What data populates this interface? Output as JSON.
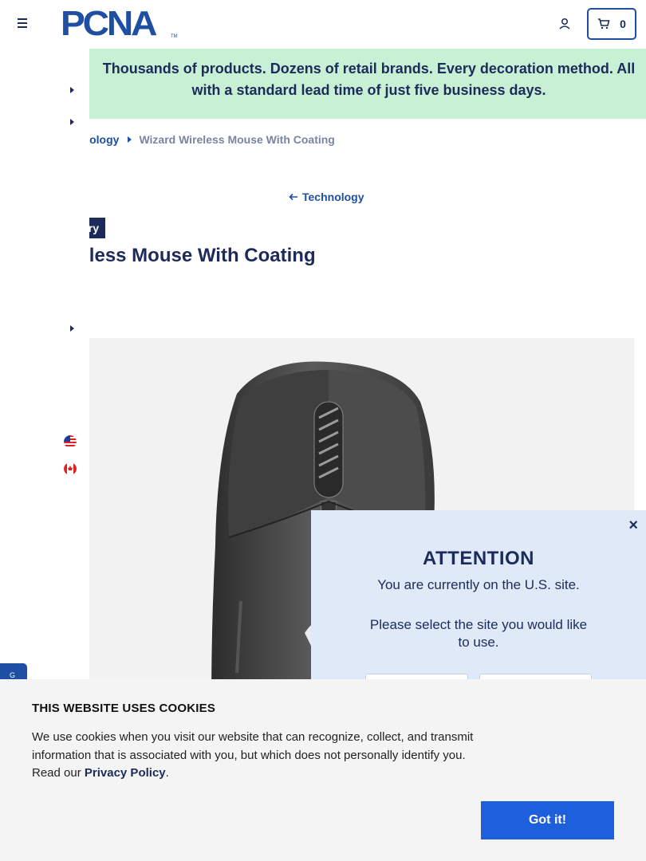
{
  "header": {
    "logo_text": "PCNA",
    "logo_tm": "TM",
    "cart_count": "0",
    "accent_color": "#1e4fa3"
  },
  "promo": {
    "text": "Thousands of products. Dozens of retail brands. Every decoration method. All with a standard lead time of just five business days.",
    "background": "#c8f0d5"
  },
  "breadcrumb": {
    "parent": "hnology",
    "current": "Wizard Wireless Mouse With Coating"
  },
  "back_link": "Technology",
  "badge": "ry",
  "product_title": "Wireless Mouse With Coating",
  "feedback_tab": "G",
  "attention": {
    "close": "×",
    "title": "ATTENTION",
    "line1": "You are currently on the U.S. site.",
    "line2": "Please select the site you would like to use."
  },
  "cookie": {
    "title": "THIS WEBSITE USES COOKIES",
    "text": "We use cookies when you visit our website that can recognize, collect, and transmit information that is associated with you, but which does not personally identify you. Read our",
    "link": "Privacy Policy",
    "period": ".",
    "button": "Got it!",
    "button_color": "#1e5fdc"
  },
  "icons": [
    "menu-icon",
    "account-icon",
    "cart-icon",
    "us-flag-icon",
    "canada-flag-icon",
    "arrow-left-icon"
  ]
}
